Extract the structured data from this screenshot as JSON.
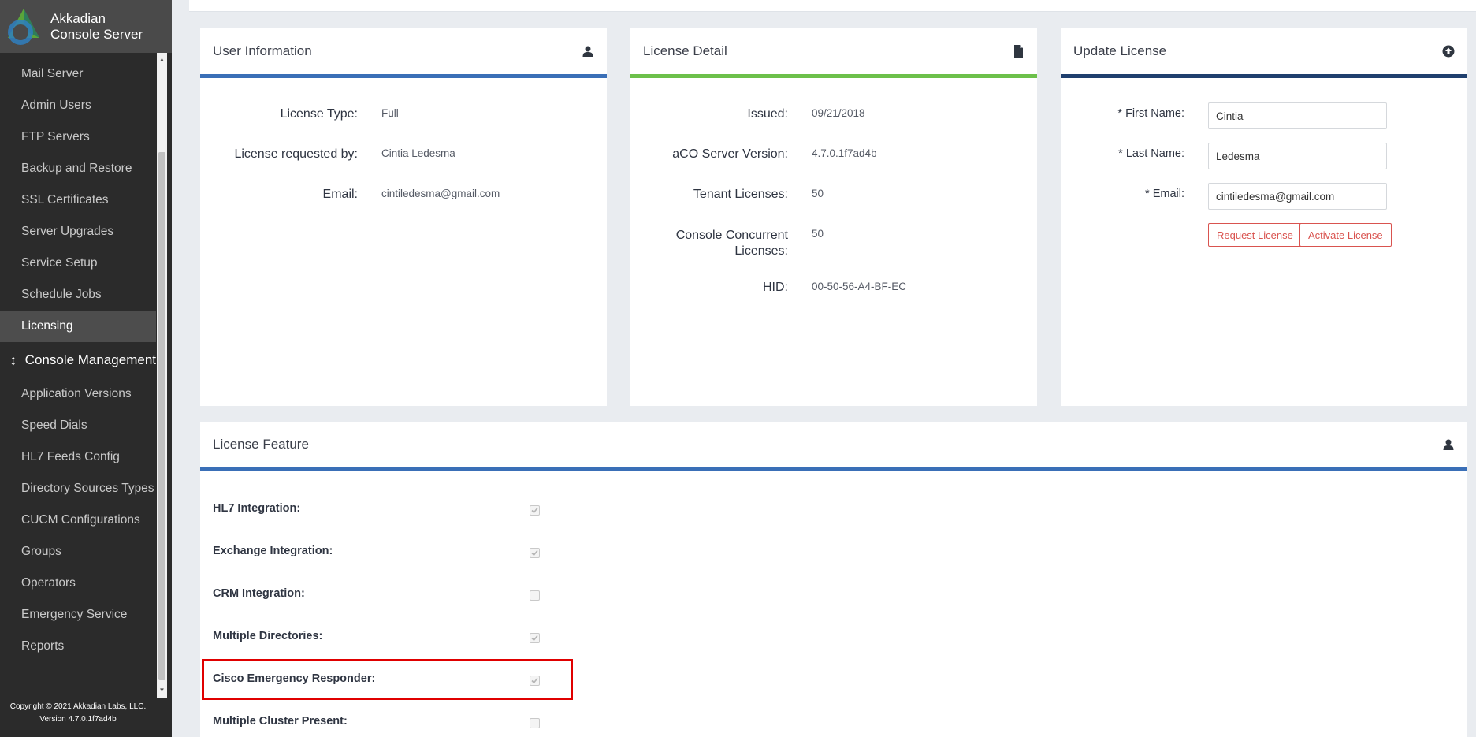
{
  "brand": {
    "line1": "Akkadian",
    "line2": "Console Server"
  },
  "sidebar": {
    "items_top": [
      {
        "label": "Mail Server"
      },
      {
        "label": "Admin Users"
      },
      {
        "label": "FTP Servers"
      },
      {
        "label": "Backup and Restore"
      },
      {
        "label": "SSL Certificates"
      },
      {
        "label": "Server Upgrades"
      },
      {
        "label": "Service Setup"
      },
      {
        "label": "Schedule Jobs"
      },
      {
        "label": "Licensing",
        "active": true
      }
    ],
    "section": {
      "label": "Console Management",
      "icon": "updown-arrow-icon"
    },
    "items_bottom": [
      {
        "label": "Application Versions"
      },
      {
        "label": "Speed Dials"
      },
      {
        "label": "HL7 Feeds Config"
      },
      {
        "label": "Directory Sources Types"
      },
      {
        "label": "CUCM Configurations"
      },
      {
        "label": "Groups"
      },
      {
        "label": "Operators"
      },
      {
        "label": "Emergency Service"
      },
      {
        "label": "Reports"
      }
    ],
    "footer": {
      "copyright": "Copyright © 2021 Akkadian Labs, LLC.",
      "version": "Version 4.7.0.1f7ad4b"
    }
  },
  "user_info": {
    "title": "User Information",
    "icon": "user-icon",
    "accent": "#3a6fb7",
    "license_type_label": "License Type:",
    "license_type": "Full",
    "requested_by_label": "License requested by:",
    "requested_by": "Cintia Ledesma",
    "email_label": "Email:",
    "email": "cintiledesma@gmail.com"
  },
  "license_detail": {
    "title": "License Detail",
    "icon": "file-icon",
    "accent": "#6cc04a",
    "issued_label": "Issued:",
    "issued": "09/21/2018",
    "version_label": "aCO Server Version:",
    "version": "4.7.0.1f7ad4b",
    "tenant_label": "Tenant Licenses:",
    "tenant": "50",
    "concurrent_label_1": "Console Concurrent",
    "concurrent_label_2": "Licenses:",
    "concurrent": "50",
    "hid_label": "HID:",
    "hid": "00-50-56-A4-BF-EC"
  },
  "update_license": {
    "title": "Update License",
    "icon": "upload-circle-icon",
    "accent": "#1f3f6e",
    "first_name_label": "* First Name:",
    "first_name": "Cintia",
    "last_name_label": "* Last Name:",
    "last_name": "Ledesma",
    "email_label": "* Email:",
    "email": "cintiledesma@gmail.com",
    "request_button": "Request License",
    "activate_button": "Activate License",
    "button_color": "#d9534f"
  },
  "license_feature": {
    "title": "License Feature",
    "icon": "user-icon",
    "accent": "#3a6fb7",
    "features": [
      {
        "label": "HL7 Integration:",
        "checked": true
      },
      {
        "label": "Exchange Integration:",
        "checked": true
      },
      {
        "label": "CRM Integration:",
        "checked": false
      },
      {
        "label": "Multiple Directories:",
        "checked": true
      },
      {
        "label": "Cisco Emergency Responder:",
        "checked": true,
        "highlighted": true
      },
      {
        "label": "Multiple Cluster Present:",
        "checked": false
      }
    ],
    "highlight_color": "#e00000"
  }
}
